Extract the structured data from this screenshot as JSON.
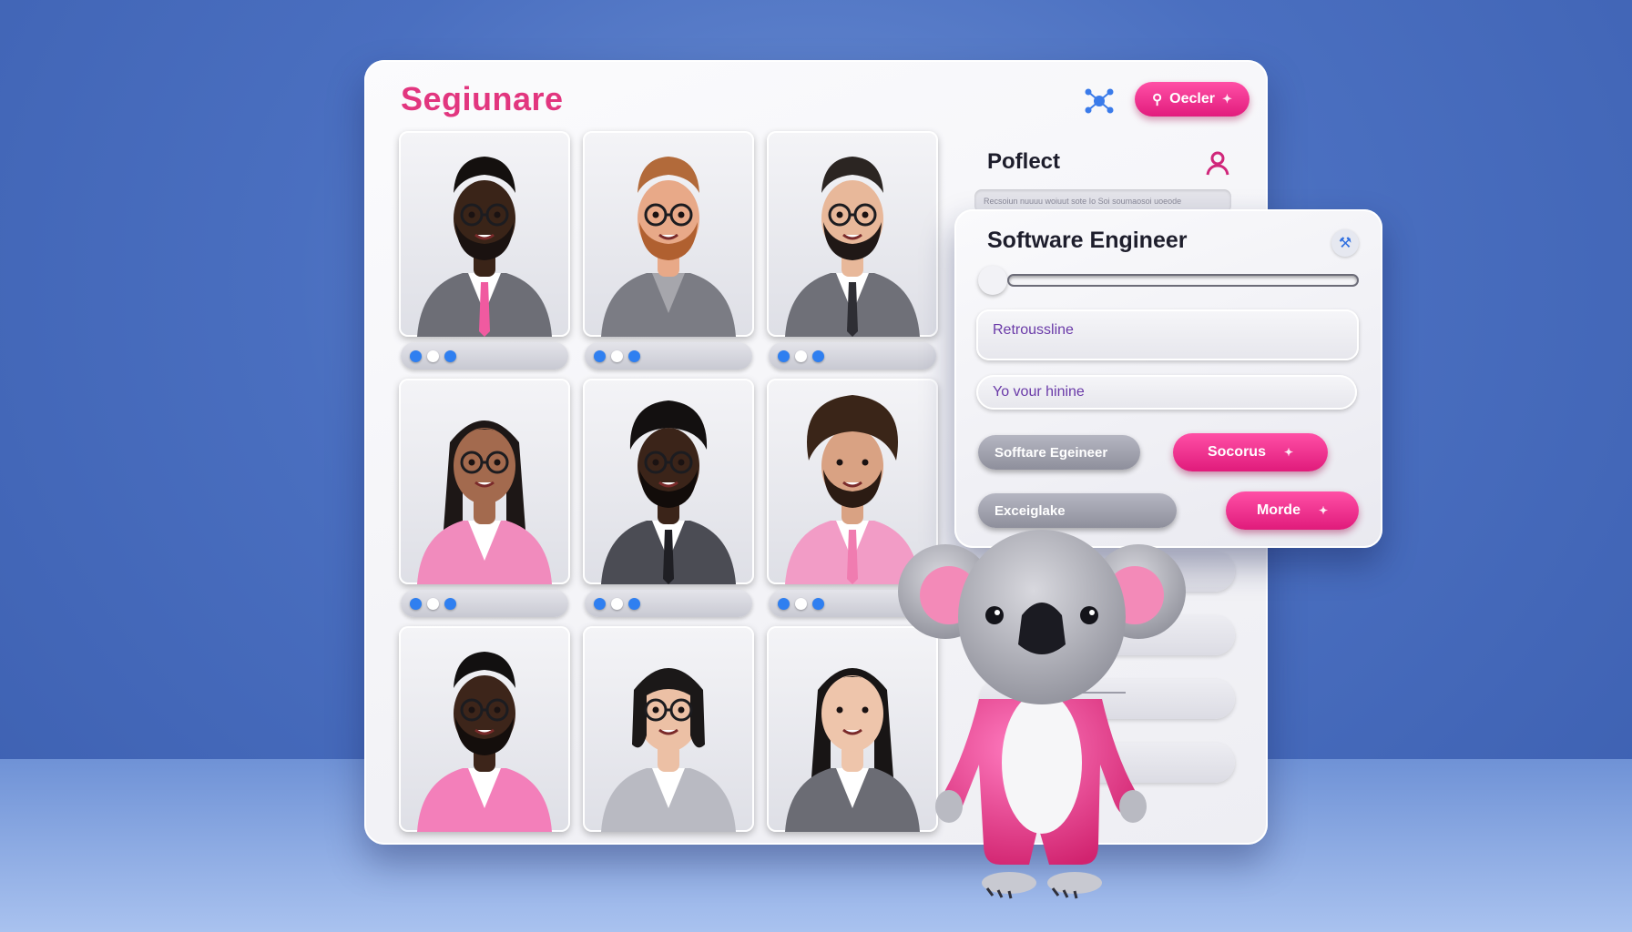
{
  "brand": "Segiunare",
  "header": {
    "search_label": "Oecler",
    "search_icon": "search-icon",
    "network_icon": "network-icon"
  },
  "profile": {
    "title": "Poflect",
    "user_icon": "user-icon",
    "subline": "Recsoiun nuuuu woiuut sote Io      Soi soumaosoi uoeode"
  },
  "detail_card": {
    "title": "Software Engineer",
    "input_one": "Retroussline",
    "input_two": "Yo vour hinine",
    "chip_one": "Sofftare Egeineer",
    "chip_two": "Exceiglake",
    "button_one": "Socorus",
    "button_two": "Morde",
    "tool_icon": "wrench-icon"
  },
  "colors": {
    "accent_pink": "#e2367f",
    "button_pink": "#ff3d9a",
    "dot_blue": "#2f7ff0",
    "background_blue": "#4a6fc0"
  },
  "candidates": [
    {
      "skin": "#3a2418",
      "hair": "#14100e",
      "shirt": "#ffffff",
      "jacket": "#6d6e76",
      "tie": "#f05aa0",
      "glasses": true,
      "beard": "#1a1210",
      "hair_style": "short"
    },
    {
      "skin": "#e8a988",
      "hair": "#b26a3a",
      "shirt": "#a6a6ac",
      "jacket": "#7b7c84",
      "tie": "",
      "glasses": true,
      "beard": "#b06030",
      "hair_style": "short"
    },
    {
      "skin": "#e8b89a",
      "hair": "#2b2522",
      "shirt": "#ffffff",
      "jacket": "#6f7078",
      "tie": "#2e2e34",
      "glasses": true,
      "beard": "#201816",
      "hair_style": "short"
    },
    {
      "skin": "#a36a4e",
      "hair": "#1d1716",
      "shirt": "#ffffff",
      "jacket": "#f18bbd",
      "tie": "",
      "glasses": true,
      "beard": "",
      "hair_style": "long"
    },
    {
      "skin": "#3b2419",
      "hair": "#131010",
      "shirt": "#ffffff",
      "jacket": "#4b4c54",
      "tie": "#1f1f24",
      "glasses": true,
      "beard": "#120c0a",
      "hair_style": "curly"
    },
    {
      "skin": "#d9a283",
      "hair": "#3a2518",
      "shirt": "#ffffff",
      "jacket": "#f29cc6",
      "tie": "#f07cb0",
      "glasses": false,
      "beard": "#2b1b13",
      "hair_style": "afro"
    },
    {
      "skin": "#3d251a",
      "hair": "#121010",
      "shirt": "#ffffff",
      "jacket": "#f37fba",
      "tie": "",
      "glasses": true,
      "beard": "#140e0c",
      "hair_style": "short"
    },
    {
      "skin": "#ecc0a5",
      "hair": "#1b1818",
      "shirt": "#ffffff",
      "jacket": "#b9bac2",
      "tie": "",
      "glasses": true,
      "beard": "",
      "hair_style": "bob"
    },
    {
      "skin": "#eec5ab",
      "hair": "#181515",
      "shirt": "#ffffff",
      "jacket": "#6b6c74",
      "tie": "",
      "glasses": false,
      "beard": "",
      "hair_style": "long"
    }
  ],
  "card_controls": {
    "dots": [
      "blue",
      "white",
      "blue"
    ]
  },
  "mascot": "koala"
}
